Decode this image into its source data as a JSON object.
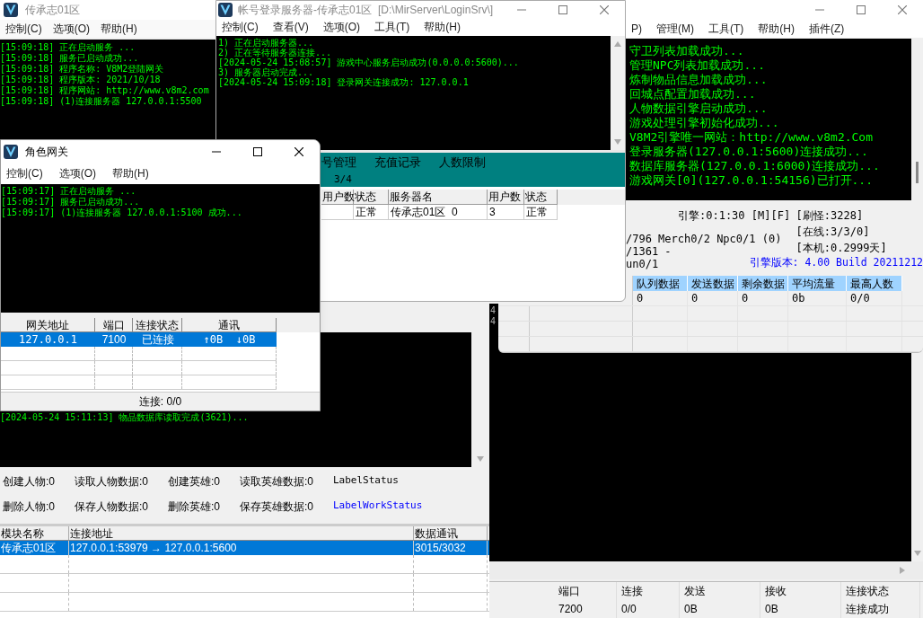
{
  "login_gate_window": {
    "title": "传承志01区",
    "menu": [
      "控制(C)",
      "选项(O)",
      "帮助(H)"
    ],
    "log": [
      "[15:09:18] 正在启动服务 ...",
      "[15:09:18] 服务已启动成功...",
      "[15:09:18] 程序名称: V8M2登陆网关",
      "[15:09:18] 程序版本: 2021/10/18",
      "[15:09:18] 程序网站: http://www.v8m2.com",
      "[15:09:18] (1)连接服务器 127.0.0.1:5500"
    ]
  },
  "login_server_window": {
    "title": "帐号登录服务器-传承志01区  [D:\\MirServer\\LoginSrv\\]",
    "menu": [
      "控制(C)",
      "查看(V)",
      "选项(O)",
      "工具(T)",
      "帮助(H)"
    ],
    "log": [
      "1) 正在启动服务器...",
      "2) 正在等待服务器连接...",
      "[2024-05-24 15:08:57] 游戏中心服务启动成功(0.0.0.0:5600)...",
      "3) 服务器启动完成...",
      "[2024-05-24 15:09:18] 登录网关连接成功: 127.0.0.1"
    ],
    "tabs": [
      {
        "label": "号管理",
        "selected": false
      },
      {
        "label": "充值记录",
        "selected": false
      },
      {
        "label": "人数限制",
        "selected": false
      }
    ],
    "server_count": "3/4",
    "table": {
      "columns": [
        "用户数",
        "状态",
        "服务器名",
        "用户数",
        "状态"
      ],
      "rows": [
        [
          "",
          "正常",
          "传承志01区  0",
          "3",
          "正常"
        ]
      ]
    }
  },
  "game_server_window": {
    "menu": [
      "P)",
      "管理(M)",
      "工具(T)",
      "帮助(H)",
      "插件(Z)"
    ],
    "log": [
      "守卫列表加载成功...",
      "管理NPC列表加载成功...",
      "炼制物品信息加载成功...",
      "回城点配置加载成功...",
      "人物数据引擎启动成功...",
      "游戏处理引擎初始化成功...",
      "V8M2引擎唯一网站：http://www.v8m2.Com",
      "登录服务器(127.0.0.1:5600)连接成功...",
      "数据库服务器(127.0.0.1:6000)连接成功...",
      "游戏网关[0](127.0.0.1:54156)已打开..."
    ],
    "engine_status": "引擎:0:1:30 [M][F]",
    "status_left": [
      "/796 Merch0/2 Npc0/1 (0)",
      "/1361 -",
      "un0/1"
    ],
    "status_right": [
      "[刷怪:3228]",
      "[在线:3/3/0]",
      "[本机:0.2999天]"
    ],
    "version": "引擎版本: 4.00 Build 20211212",
    "table": {
      "columns": [
        "队列数据",
        "发送数据",
        "剩余数据",
        "平均流量",
        "最高人数"
      ],
      "rows": [
        [
          "0",
          "0",
          "0",
          "0b",
          "0/0"
        ]
      ]
    }
  },
  "role_gate_window": {
    "title": "角色网关",
    "menu": [
      "控制(C)",
      "选项(O)",
      "帮助(H)"
    ],
    "log": [
      "[15:09:17] 正在启动服务 ...",
      "[15:09:17] 服务已启动成功...",
      "[15:09:17] (1)连接服务器 127.0.0.1:5100 成功..."
    ],
    "table": {
      "columns": [
        "网关地址",
        "端口",
        "连接状态",
        "通讯"
      ],
      "rows": [
        {
          "cells": [
            "127.0.0.1",
            "7100",
            "已连接",
            "↑0B  ↓0B"
          ],
          "selected": true
        }
      ]
    },
    "status_bar": "连接: 0/0"
  },
  "db_server_window": {
    "log": [
      "[2024-05-24 15:11:13] 物品数据库读取完成(3621)..."
    ],
    "counters": [
      "创建人物:0",
      "读取人物数据:0",
      "创建英雄:0",
      "读取英雄数据:0",
      "删除人物:0",
      "保存人物数据:0",
      "删除英雄:0",
      "保存英雄数据:0"
    ],
    "status_label": "LabelStatus",
    "work_status_label": "LabelWorkStatus",
    "table": {
      "columns": [
        "模块名称",
        "连接地址",
        "数据通讯"
      ],
      "rows": [
        {
          "cells": [
            "传承志01区",
            "127.0.0.1:53979 → 127.0.0.1:5600",
            "3015/3032"
          ],
          "selected": true
        }
      ]
    }
  },
  "gate_window": {
    "log": [
      "4",
      "4"
    ],
    "table": {
      "columns": [
        "端口",
        "连接",
        "发送",
        "接收",
        "连接状态"
      ],
      "rows": [
        [
          "7200",
          "0/0",
          "0B",
          "0B",
          "连接成功"
        ]
      ]
    }
  }
}
